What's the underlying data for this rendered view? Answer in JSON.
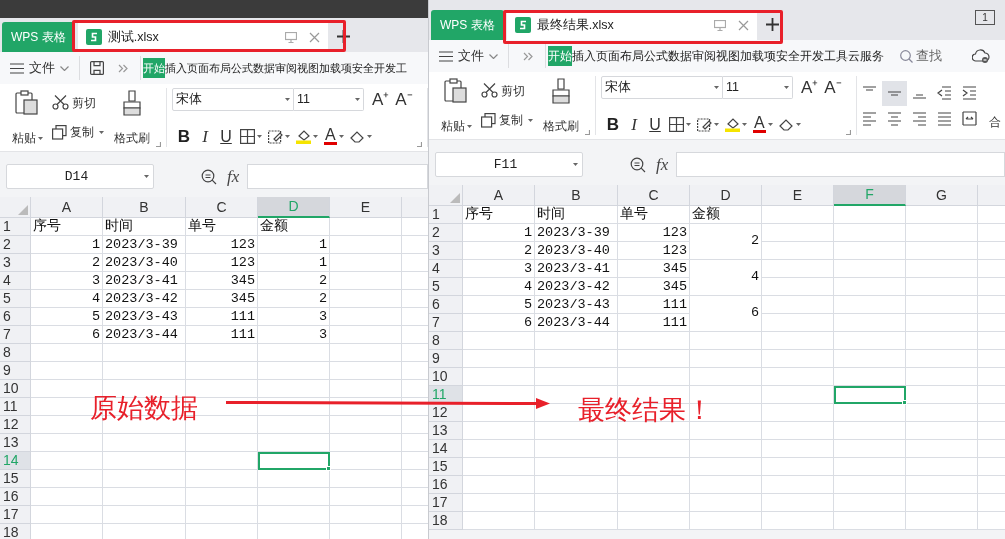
{
  "windows": [
    {
      "app_tab": "WPS 表格",
      "doc_tab": "测试.xlsx",
      "file_menu": "文件",
      "ribbon_tabs": [
        {
          "label": "开始",
          "selected": true
        },
        {
          "label": "插入",
          "selected": false
        },
        {
          "label": "页面布局",
          "selected": false
        },
        {
          "label": "公式",
          "selected": false
        },
        {
          "label": "数据",
          "selected": false
        },
        {
          "label": "审阅",
          "selected": false
        },
        {
          "label": "视图",
          "selected": false
        },
        {
          "label": "加载项",
          "selected": false
        },
        {
          "label": "安全",
          "selected": false
        },
        {
          "label": "开发工",
          "selected": false
        }
      ],
      "clipboard": {
        "paste": "粘贴",
        "cut": "剪切",
        "copy": "复制",
        "format_painter": "格式刷"
      },
      "font": {
        "name": "宋体",
        "size": "11",
        "grow": "A⁺",
        "shrink": "A⁻",
        "bold": "B",
        "italic": "I",
        "underline": "U",
        "font_color_button": "A"
      },
      "name_box": "D14",
      "fx": "fx",
      "columns": [
        {
          "label": "A",
          "selected": false
        },
        {
          "label": "B",
          "selected": false
        },
        {
          "label": "C",
          "selected": false
        },
        {
          "label": "D",
          "selected": true
        },
        {
          "label": "E",
          "selected": false
        }
      ],
      "rows": [
        {
          "number": "1",
          "selected": false,
          "cells": [
            {
              "text": "序号",
              "kind": "text"
            },
            {
              "text": "时间",
              "kind": "text"
            },
            {
              "text": "单号",
              "kind": "text"
            },
            {
              "text": "金额",
              "kind": "text"
            }
          ]
        },
        {
          "number": "2",
          "selected": false,
          "cells": [
            {
              "text": "1",
              "kind": "number"
            },
            {
              "text": "2023/3-39",
              "kind": "text"
            },
            {
              "text": "123",
              "kind": "number"
            },
            {
              "text": "1",
              "kind": "number"
            }
          ]
        },
        {
          "number": "3",
          "selected": false,
          "cells": [
            {
              "text": "2",
              "kind": "number"
            },
            {
              "text": "2023/3-40",
              "kind": "text"
            },
            {
              "text": "123",
              "kind": "number"
            },
            {
              "text": "1",
              "kind": "number"
            }
          ]
        },
        {
          "number": "4",
          "selected": false,
          "cells": [
            {
              "text": "3",
              "kind": "number"
            },
            {
              "text": "2023/3-41",
              "kind": "text"
            },
            {
              "text": "345",
              "kind": "number"
            },
            {
              "text": "2",
              "kind": "number"
            }
          ]
        },
        {
          "number": "5",
          "selected": false,
          "cells": [
            {
              "text": "4",
              "kind": "number"
            },
            {
              "text": "2023/3-42",
              "kind": "text"
            },
            {
              "text": "345",
              "kind": "number"
            },
            {
              "text": "2",
              "kind": "number"
            }
          ]
        },
        {
          "number": "6",
          "selected": false,
          "cells": [
            {
              "text": "5",
              "kind": "number"
            },
            {
              "text": "2023/3-43",
              "kind": "text"
            },
            {
              "text": "111",
              "kind": "number"
            },
            {
              "text": "3",
              "kind": "number"
            }
          ]
        },
        {
          "number": "7",
          "selected": false,
          "cells": [
            {
              "text": "6",
              "kind": "number"
            },
            {
              "text": "2023/3-44",
              "kind": "text"
            },
            {
              "text": "111",
              "kind": "number"
            },
            {
              "text": "3",
              "kind": "number"
            }
          ]
        },
        {
          "number": "8",
          "selected": false
        },
        {
          "number": "9",
          "selected": false
        },
        {
          "number": "10",
          "selected": false
        },
        {
          "number": "11",
          "selected": false
        },
        {
          "number": "12",
          "selected": false
        },
        {
          "number": "13",
          "selected": false
        },
        {
          "number": "14",
          "selected": true
        },
        {
          "number": "15",
          "selected": false
        },
        {
          "number": "16",
          "selected": false
        },
        {
          "number": "17",
          "selected": false
        },
        {
          "number": "18",
          "selected": false
        }
      ]
    },
    {
      "app_tab": "WPS 表格",
      "doc_tab": "最终结果.xlsx",
      "window_count": "1",
      "file_menu": "文件",
      "ribbon_tabs": [
        {
          "label": "开始",
          "selected": true
        },
        {
          "label": "插入",
          "selected": false
        },
        {
          "label": "页面布局",
          "selected": false
        },
        {
          "label": "公式",
          "selected": false
        },
        {
          "label": "数据",
          "selected": false
        },
        {
          "label": "审阅",
          "selected": false
        },
        {
          "label": "视图",
          "selected": false
        },
        {
          "label": "加载项",
          "selected": false
        },
        {
          "label": "安全",
          "selected": false
        },
        {
          "label": "开发工具",
          "selected": false
        },
        {
          "label": "云服务",
          "selected": false
        }
      ],
      "search": "查找",
      "clipboard": {
        "paste": "粘贴",
        "cut": "剪切",
        "copy": "复制",
        "format_painter": "格式刷"
      },
      "font": {
        "name": "宋体",
        "size": "11",
        "grow": "A⁺",
        "shrink": "A⁻",
        "bold": "B",
        "italic": "I",
        "underline": "U",
        "font_color_button": "A"
      },
      "alignment": {
        "merge": "合"
      },
      "name_box": "F11",
      "fx": "fx",
      "columns": [
        {
          "label": "A",
          "selected": false
        },
        {
          "label": "B",
          "selected": false
        },
        {
          "label": "C",
          "selected": false
        },
        {
          "label": "D",
          "selected": false
        },
        {
          "label": "E",
          "selected": false
        },
        {
          "label": "F",
          "selected": true
        },
        {
          "label": "G",
          "selected": false
        }
      ],
      "rows": [
        {
          "number": "1",
          "selected": false,
          "cells": [
            {
              "text": "序号",
              "kind": "text"
            },
            {
              "text": "时间",
              "kind": "text"
            },
            {
              "text": "单号",
              "kind": "text"
            },
            {
              "text": "金额",
              "kind": "text"
            }
          ]
        },
        {
          "number": "2",
          "selected": false,
          "cells": [
            {
              "text": "1",
              "kind": "number"
            },
            {
              "text": "2023/3-39",
              "kind": "text"
            },
            {
              "text": "123",
              "kind": "number"
            },
            {
              "text": "2",
              "kind": "number",
              "merged_down": true
            }
          ]
        },
        {
          "number": "3",
          "selected": false,
          "cells": [
            {
              "text": "2",
              "kind": "number"
            },
            {
              "text": "2023/3-40",
              "kind": "text"
            },
            {
              "text": "123",
              "kind": "number"
            }
          ]
        },
        {
          "number": "4",
          "selected": false,
          "cells": [
            {
              "text": "3",
              "kind": "number"
            },
            {
              "text": "2023/3-41",
              "kind": "text"
            },
            {
              "text": "345",
              "kind": "number"
            },
            {
              "text": "4",
              "kind": "number",
              "merged_down": true
            }
          ]
        },
        {
          "number": "5",
          "selected": false,
          "cells": [
            {
              "text": "4",
              "kind": "number"
            },
            {
              "text": "2023/3-42",
              "kind": "text"
            },
            {
              "text": "345",
              "kind": "number"
            }
          ]
        },
        {
          "number": "6",
          "selected": false,
          "cells": [
            {
              "text": "5",
              "kind": "number"
            },
            {
              "text": "2023/3-43",
              "kind": "text"
            },
            {
              "text": "111",
              "kind": "number"
            },
            {
              "text": "6",
              "kind": "number",
              "merged_down": true
            }
          ]
        },
        {
          "number": "7",
          "selected": false,
          "cells": [
            {
              "text": "6",
              "kind": "number"
            },
            {
              "text": "2023/3-44",
              "kind": "text"
            },
            {
              "text": "111",
              "kind": "number"
            }
          ]
        },
        {
          "number": "8",
          "selected": false
        },
        {
          "number": "9",
          "selected": false
        },
        {
          "number": "10",
          "selected": false
        },
        {
          "number": "11",
          "selected": true
        },
        {
          "number": "12",
          "selected": false
        },
        {
          "number": "13",
          "selected": false
        },
        {
          "number": "14",
          "selected": false
        },
        {
          "number": "15",
          "selected": false
        },
        {
          "number": "16",
          "selected": false
        },
        {
          "number": "17",
          "selected": false
        },
        {
          "number": "18",
          "selected": false
        }
      ]
    }
  ],
  "annotations": [
    {
      "kind": "label",
      "text": "原始数据"
    },
    {
      "kind": "arrow"
    },
    {
      "kind": "label",
      "text": "最终结果！"
    }
  ]
}
